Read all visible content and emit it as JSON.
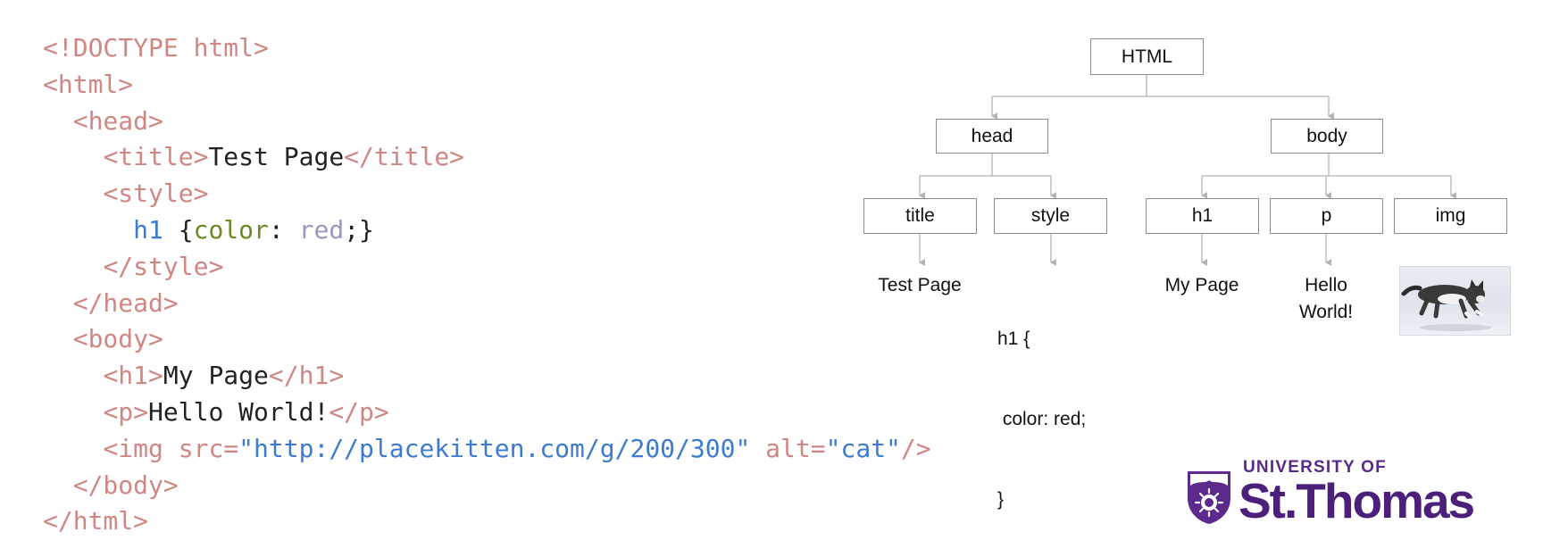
{
  "code": {
    "lines": [
      [
        {
          "t": "<!DOCTYPE html>",
          "c": "tag"
        }
      ],
      [
        {
          "t": "<html>",
          "c": "tag"
        }
      ],
      [
        {
          "t": "  ",
          "c": "text"
        },
        {
          "t": "<head>",
          "c": "tag"
        }
      ],
      [
        {
          "t": "    ",
          "c": "text"
        },
        {
          "t": "<title>",
          "c": "tag"
        },
        {
          "t": "Test Page",
          "c": "text"
        },
        {
          "t": "</title>",
          "c": "tag"
        }
      ],
      [
        {
          "t": "    ",
          "c": "text"
        },
        {
          "t": "<style>",
          "c": "tag"
        }
      ],
      [
        {
          "t": "      ",
          "c": "text"
        },
        {
          "t": "h1",
          "c": "sel"
        },
        {
          "t": " {",
          "c": "text"
        },
        {
          "t": "color",
          "c": "prop"
        },
        {
          "t": ": ",
          "c": "text"
        },
        {
          "t": "red",
          "c": "val"
        },
        {
          "t": ";}",
          "c": "text"
        }
      ],
      [
        {
          "t": "    ",
          "c": "text"
        },
        {
          "t": "</style>",
          "c": "tag"
        }
      ],
      [
        {
          "t": "  ",
          "c": "text"
        },
        {
          "t": "</head>",
          "c": "tag"
        }
      ],
      [
        {
          "t": "  ",
          "c": "text"
        },
        {
          "t": "<body>",
          "c": "tag"
        }
      ],
      [
        {
          "t": "    ",
          "c": "text"
        },
        {
          "t": "<h1>",
          "c": "tag"
        },
        {
          "t": "My Page",
          "c": "text"
        },
        {
          "t": "</h1>",
          "c": "tag"
        }
      ],
      [
        {
          "t": "    ",
          "c": "text"
        },
        {
          "t": "<p>",
          "c": "tag"
        },
        {
          "t": "Hello World!",
          "c": "text"
        },
        {
          "t": "</p>",
          "c": "tag"
        }
      ],
      [
        {
          "t": "    ",
          "c": "text"
        },
        {
          "t": "<img ",
          "c": "tag"
        },
        {
          "t": "src=",
          "c": "attr"
        },
        {
          "t": "\"http://placekitten.com/g/200/300\"",
          "c": "str"
        },
        {
          "t": " alt=",
          "c": "attr"
        },
        {
          "t": "\"cat\"",
          "c": "str"
        },
        {
          "t": "/>",
          "c": "tag"
        }
      ],
      [
        {
          "t": "  ",
          "c": "text"
        },
        {
          "t": "</body>",
          "c": "tag"
        }
      ],
      [
        {
          "t": "</html>",
          "c": "tag"
        }
      ]
    ]
  },
  "tree": {
    "root": "HTML",
    "head": "head",
    "body": "body",
    "title": "title",
    "style": "style",
    "h1": "h1",
    "p": "p",
    "img": "img",
    "leaf_title": "Test Page",
    "leaf_style_1": "h1 {",
    "leaf_style_2": " color: red;",
    "leaf_style_3": "}",
    "leaf_h1": "My Page",
    "leaf_p_1": "Hello",
    "leaf_p_2": "World!"
  },
  "logo": {
    "top": "UNIVERSITY OF",
    "main": "St.Thomas"
  },
  "colors": {
    "tag": "#d08784",
    "string": "#3c7bd0",
    "property": "#6b8a24",
    "value": "#9e95c2",
    "brand": "#4b1f7a"
  },
  "icons": {
    "crest": "university-crest-icon",
    "photo": "cat-photo"
  }
}
